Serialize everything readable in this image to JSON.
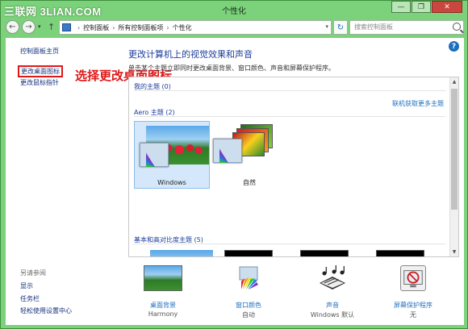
{
  "window": {
    "title": "个性化",
    "watermark": "三联网 3LIAN.COM",
    "minimize_glyph": "—",
    "restore_glyph": "❐",
    "close_glyph": "✕"
  },
  "nav": {
    "back_glyph": "←",
    "forward_glyph": "→",
    "history_glyph": "▾",
    "up_glyph": "↑",
    "breadcrumbs": [
      "控制面板",
      "所有控制面板项",
      "个性化"
    ],
    "breadcrumb_sep": "›",
    "address_dropdown_glyph": "▾",
    "refresh_glyph": "↻",
    "search_placeholder": "搜索控制面板"
  },
  "help_glyph": "?",
  "sidebar": {
    "home": "控制面板主页",
    "change_desktop_icons": "更改桌面图标",
    "change_mouse_pointer": "更改鼠标指针",
    "see_also_title": "另请参阅",
    "see_also": [
      "显示",
      "任务栏",
      "轻松使用设置中心"
    ]
  },
  "annotation": "选择更改桌面图标",
  "main": {
    "heading": "更改计算机上的视觉效果和声音",
    "subtext": "单击某个主题立即同时更改桌面背景、窗口颜色、声音和屏幕保护程序。"
  },
  "themes": {
    "my_themes_label": "我的主题 (0)",
    "online_link": "联机获取更多主题",
    "aero_label": "Aero 主题 (2)",
    "aero_items": [
      {
        "name": "Windows",
        "selected": true
      },
      {
        "name": "自然",
        "selected": false
      }
    ],
    "basic_label": "基本和高对比度主题 (5)",
    "basic_accent_colors": [
      "#1a3fbf",
      "#22d4d4",
      "#5a2a9a"
    ],
    "scroll_up_glyph": "▲",
    "scroll_down_glyph": "▼"
  },
  "bottom": {
    "items": [
      {
        "label": "桌面背景",
        "value": "Harmony",
        "icon": "desktop-background-icon"
      },
      {
        "label": "窗口颜色",
        "value": "自动",
        "icon": "window-color-icon"
      },
      {
        "label": "声音",
        "value": "Windows 默认",
        "icon": "sound-icon"
      },
      {
        "label": "屏幕保护程序",
        "value": "无",
        "icon": "screensaver-icon"
      }
    ]
  }
}
